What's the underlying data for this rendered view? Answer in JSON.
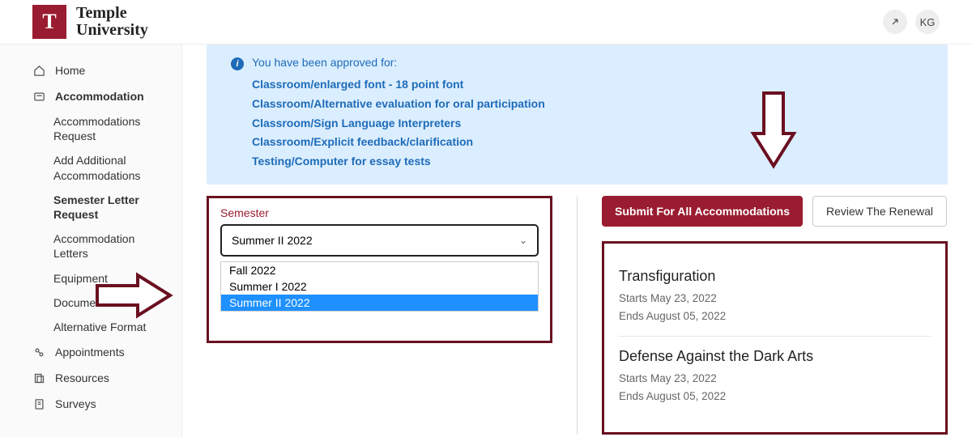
{
  "header": {
    "logo_letter": "T",
    "logo_line1": "Temple",
    "logo_line2": "University",
    "user_initials": "KG"
  },
  "sidebar": {
    "items": [
      {
        "icon": "home",
        "label": "Home"
      },
      {
        "icon": "accommodation",
        "label": "Accommodation",
        "bold": true
      },
      {
        "icon": "appointments",
        "label": "Appointments"
      },
      {
        "icon": "resources",
        "label": "Resources"
      },
      {
        "icon": "surveys",
        "label": "Surveys"
      }
    ],
    "sub_items": [
      {
        "label": "Accommodations Request"
      },
      {
        "label": "Add Additional Accommodations"
      },
      {
        "label": "Semester Letter Request",
        "bold": true
      },
      {
        "label": "Accommodation Letters"
      },
      {
        "label": "Equipment"
      },
      {
        "label": "Documents"
      },
      {
        "label": "Alternative Format"
      }
    ]
  },
  "banner": {
    "intro": "You have been approved for:",
    "links": [
      "Classroom/enlarged font - 18 point font",
      "Classroom/Alternative evaluation for oral participation",
      "Classroom/Sign Language Interpreters",
      "Classroom/Explicit feedback/clarification",
      "Testing/Computer for essay tests"
    ]
  },
  "semester": {
    "label": "Semester",
    "selected": "Summer II 2022",
    "options": [
      "Fall 2022",
      "Summer I 2022",
      "Summer II 2022"
    ]
  },
  "buttons": {
    "submit": "Submit For All Accommodations",
    "review": "Review The Renewal"
  },
  "courses": [
    {
      "title": "Transfiguration",
      "starts": "Starts May 23, 2022",
      "ends": "Ends August 05, 2022"
    },
    {
      "title": "Defense Against the Dark Arts",
      "starts": "Starts May 23, 2022",
      "ends": "Ends August 05, 2022"
    }
  ]
}
